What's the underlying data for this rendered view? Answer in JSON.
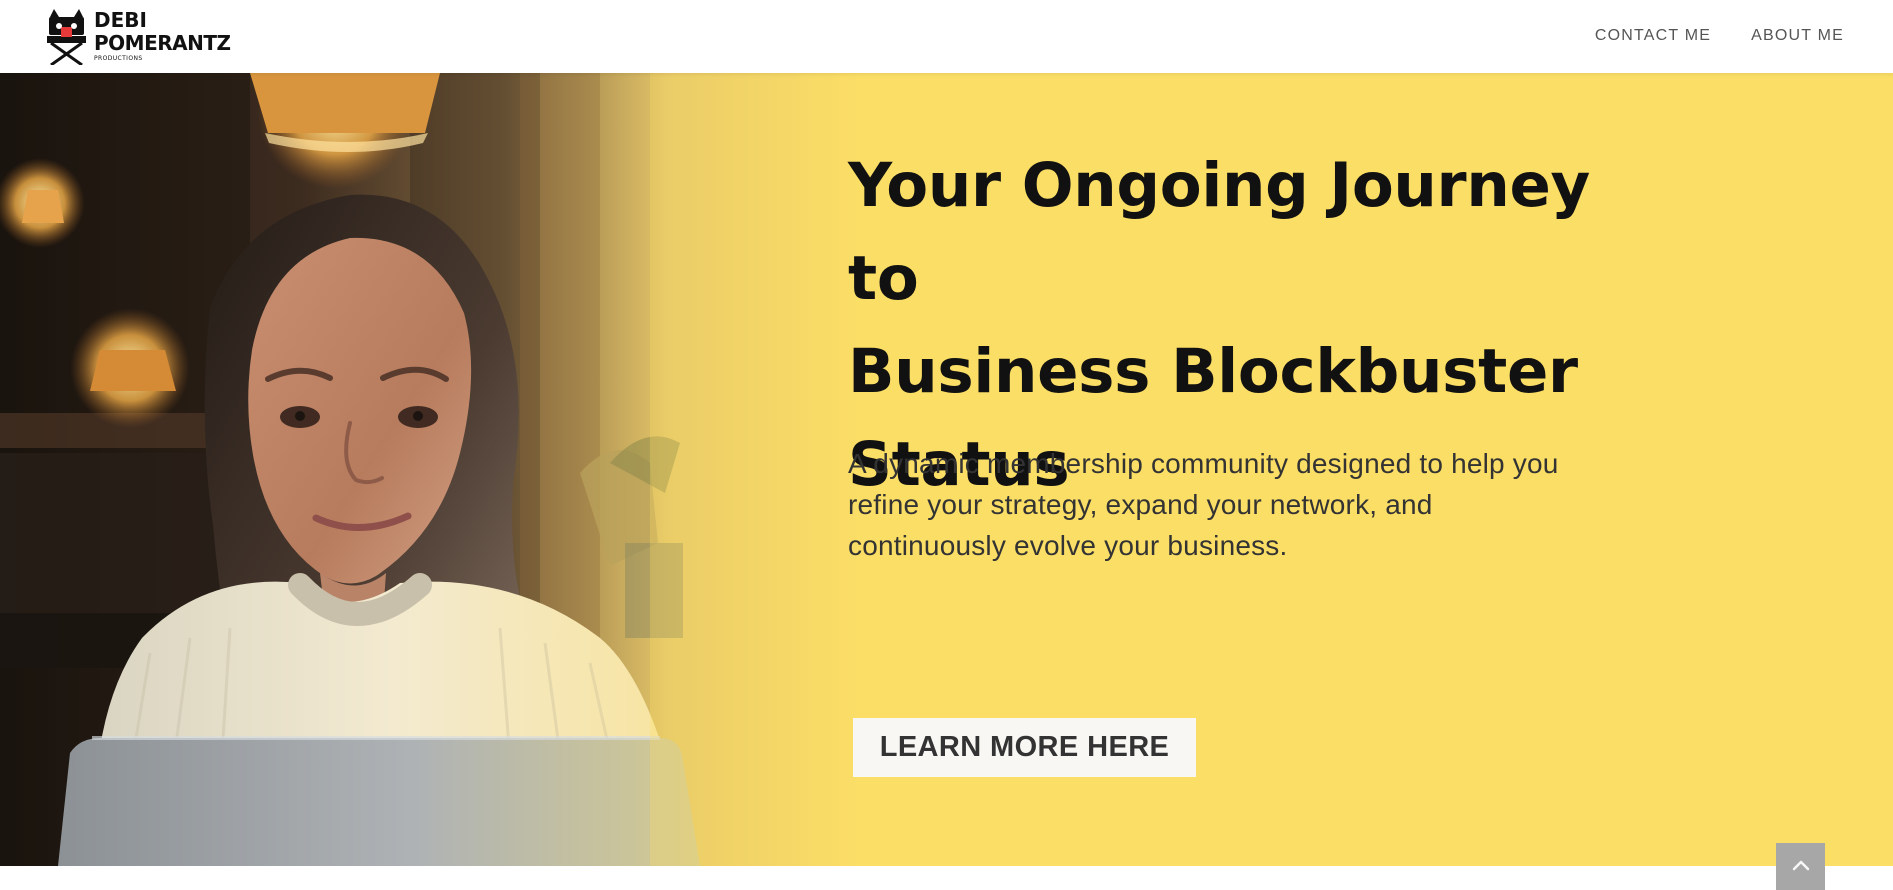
{
  "header": {
    "logo": {
      "line_1": "DEBI",
      "line_2": "POMERANTZ",
      "line_3": "PRODUCTIONS",
      "icon": "director-chair-logo-icon"
    },
    "nav": [
      {
        "label": "CONTACT ME"
      },
      {
        "label": "ABOUT ME"
      }
    ]
  },
  "hero": {
    "headline": [
      "Your Ongoing Journey to",
      "Business Blockbuster",
      "Status"
    ],
    "subtext": [
      "A dynamic membership community designed to help you",
      "refine your strategy, expand your network, and",
      "continuously evolve your business."
    ],
    "cta_label": "LEARN MORE HERE",
    "image_icon": "woman-with-laptop-photo"
  },
  "scroll_top": {
    "icon": "chevron-up-icon"
  },
  "colors": {
    "hero_yellow": "#fbde66",
    "cta_background": "#f8f7f4",
    "scroll_button": "#a7a7a7"
  }
}
